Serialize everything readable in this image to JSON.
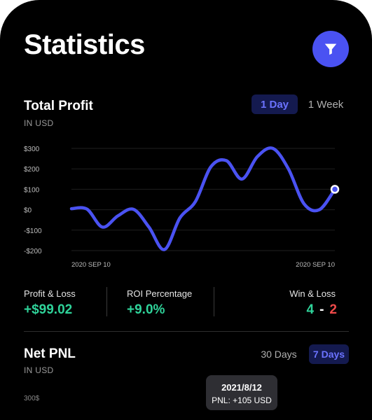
{
  "page": {
    "title": "Statistics"
  },
  "filter": {
    "icon": "filter-icon",
    "color": "#4a52f2"
  },
  "profit": {
    "title": "Total Profit",
    "unit": "IN USD",
    "ranges": [
      "1 Day",
      "1 Week"
    ],
    "selected_range": "1 Day"
  },
  "chart_data": {
    "type": "line",
    "title": "Total Profit",
    "xlabel": "",
    "ylabel": "IN USD",
    "y_ticks": [
      "$300",
      "$200",
      "$100",
      "$0",
      "-$100",
      "-$200"
    ],
    "ylim": [
      -200,
      300
    ],
    "x_labels": [
      "2020 SEP 10",
      "2020 SEP 10"
    ],
    "grid": true,
    "series": [
      {
        "color": "#4a52f2",
        "values": [
          5,
          3,
          -85,
          -30,
          2,
          -85,
          -195,
          -40,
          40,
          210,
          240,
          150,
          260,
          300,
          200,
          30,
          0,
          100
        ]
      }
    ]
  },
  "stats": {
    "pnl_label": "Profit & Loss",
    "pnl_value": "+$99.02",
    "roi_label": "ROI Percentage",
    "roi_value": "+9.0%",
    "winloss_label": "Win & Loss",
    "wins": "4",
    "separator": "-",
    "losses": "2",
    "colors": {
      "positive": "#2fd39a",
      "negative": "#f04a4a"
    }
  },
  "net_pnl": {
    "title": "Net PNL",
    "unit": "IN USD",
    "ranges": [
      "30 Days",
      "7 Days"
    ],
    "selected_range": "7 Days",
    "tooltip_date": "2021/8/12",
    "tooltip_value": "PNL: +105 USD",
    "first_tick": "300$"
  }
}
